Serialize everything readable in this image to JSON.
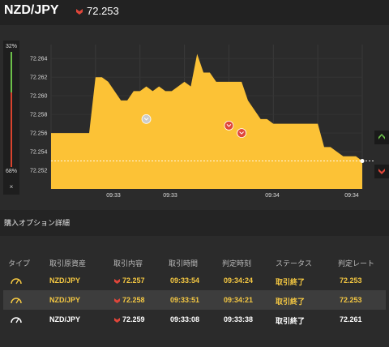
{
  "header": {
    "pair": "NZD/JPY",
    "rate": "72.253",
    "rate_direction_icon": "down-arrow-icon",
    "colors": {
      "down": "#e0463a",
      "up": "#6cc04a"
    }
  },
  "gauge": {
    "top_label": "32%",
    "bottom_label": "68%",
    "close_label": "×",
    "up_share": 0.32,
    "down_share": 0.68
  },
  "chart_data": {
    "type": "area",
    "ylim": [
      72.25,
      72.2655
    ],
    "y_ticks": [
      "72.264",
      "72.262",
      "72.260",
      "72.258",
      "72.256",
      "72.254",
      "72.252"
    ],
    "x_ticks": [
      "09:33",
      "09:33",
      "09:34",
      "09:34"
    ],
    "current_rate": 72.253,
    "fill_color": "#fcc236",
    "series": [
      {
        "values": [
          72.256,
          72.256,
          72.256,
          72.256,
          72.256,
          72.256,
          72.256,
          72.262,
          72.262,
          72.2615,
          72.2605,
          72.2595,
          72.2595,
          72.2605,
          72.2605,
          72.261,
          72.2605,
          72.261,
          72.2605,
          72.2605,
          72.261,
          72.2615,
          72.261,
          72.2645,
          72.2625,
          72.2625,
          72.2615,
          72.2615,
          72.2615,
          72.2615,
          72.2615,
          72.2595,
          72.2585,
          72.2575,
          72.2575,
          72.257,
          72.257,
          72.257,
          72.257,
          72.257,
          72.257,
          72.257,
          72.257,
          72.2545,
          72.2545,
          72.254,
          72.2535,
          72.2535,
          72.2535,
          72.253
        ]
      }
    ],
    "markers": [
      {
        "index": 15,
        "value": 72.2575,
        "color": "#cccccc"
      },
      {
        "index": 28,
        "value": 72.2568,
        "color": "#e0463a"
      },
      {
        "index": 30,
        "value": 72.256,
        "color": "#e0463a"
      }
    ]
  },
  "option_details": {
    "title": "購入オプション詳細"
  },
  "table": {
    "headers": [
      "タイプ",
      "取引原資産",
      "取引内容",
      "取引時間",
      "判定時刻",
      "ステータス",
      "判定レート"
    ],
    "rows": [
      {
        "pair": "NZD/JPY",
        "rate": "72.257",
        "trade_time": "09:33:54",
        "judge_time": "09:34:24",
        "status": "取引終了",
        "judge_rate": "72.253",
        "color": "gold"
      },
      {
        "pair": "NZD/JPY",
        "rate": "72.258",
        "trade_time": "09:33:51",
        "judge_time": "09:34:21",
        "status": "取引終了",
        "judge_rate": "72.253",
        "color": "gold"
      },
      {
        "pair": "NZD/JPY",
        "rate": "72.259",
        "trade_time": "09:33:08",
        "judge_time": "09:33:38",
        "status": "取引終了",
        "judge_rate": "72.261",
        "color": "white"
      }
    ]
  }
}
